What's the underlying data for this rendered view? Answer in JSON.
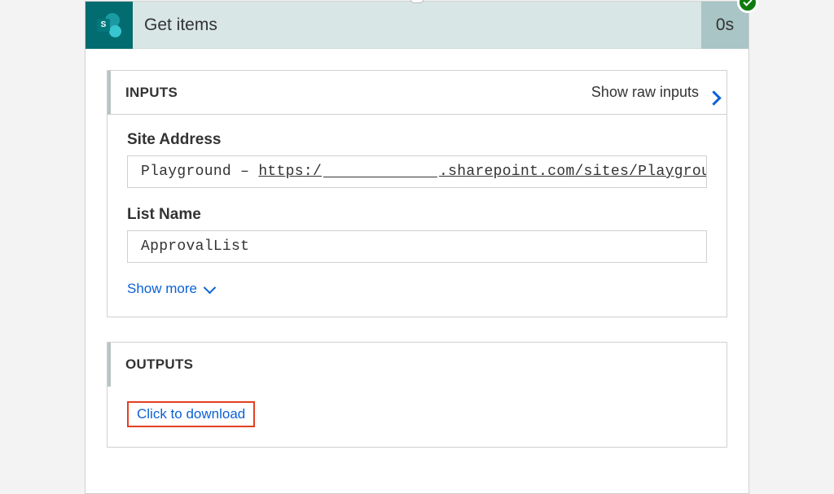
{
  "header": {
    "title": "Get items",
    "duration": "0s",
    "icon_letter": "S",
    "icon_name": "sharepoint-icon",
    "status": "success"
  },
  "inputs": {
    "section_label": "INPUTS",
    "show_raw_label": "Show raw inputs",
    "fields": {
      "site_address": {
        "label": "Site Address",
        "prefix": "Playground – ",
        "url_scheme": "https:/",
        "url_suffix": ".sharepoint.com/sites/Playground"
      },
      "list_name": {
        "label": "List Name",
        "value": "ApprovalList"
      }
    },
    "show_more_label": "Show more"
  },
  "outputs": {
    "section_label": "OUTPUTS",
    "download_label": "Click to download"
  }
}
